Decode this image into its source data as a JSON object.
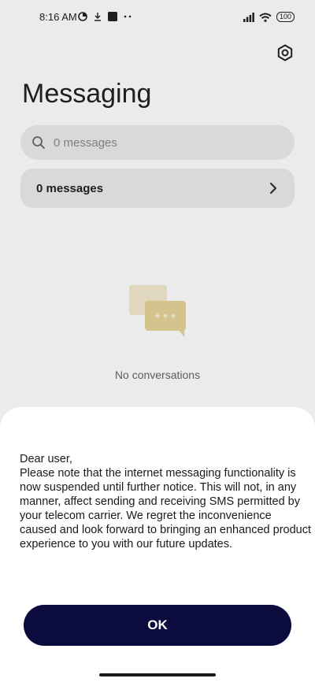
{
  "status_bar": {
    "time": "8:16 AM",
    "battery": "100"
  },
  "header": {
    "title": "Messaging"
  },
  "search": {
    "placeholder": "0 messages"
  },
  "messages_row": {
    "label": "0 messages"
  },
  "empty_state": {
    "label": "No conversations"
  },
  "dialog": {
    "message": "Dear user,\nPlease note that the internet messaging functionality is now suspended until further notice. This will not, in any manner, affect sending and receiving SMS permitted by your telecom carrier. We regret the inconvenience caused and look forward to bringing an enhanced product experience to you with our future updates.",
    "ok_label": "OK"
  },
  "colors": {
    "button_bg": "#0b0b3e",
    "illustration_accent": "#e9d9a7"
  },
  "icons": [
    "settings-icon",
    "search-icon",
    "chevron-right-icon",
    "chat-bubbles-icon",
    "signal-icon",
    "wifi-icon"
  ]
}
